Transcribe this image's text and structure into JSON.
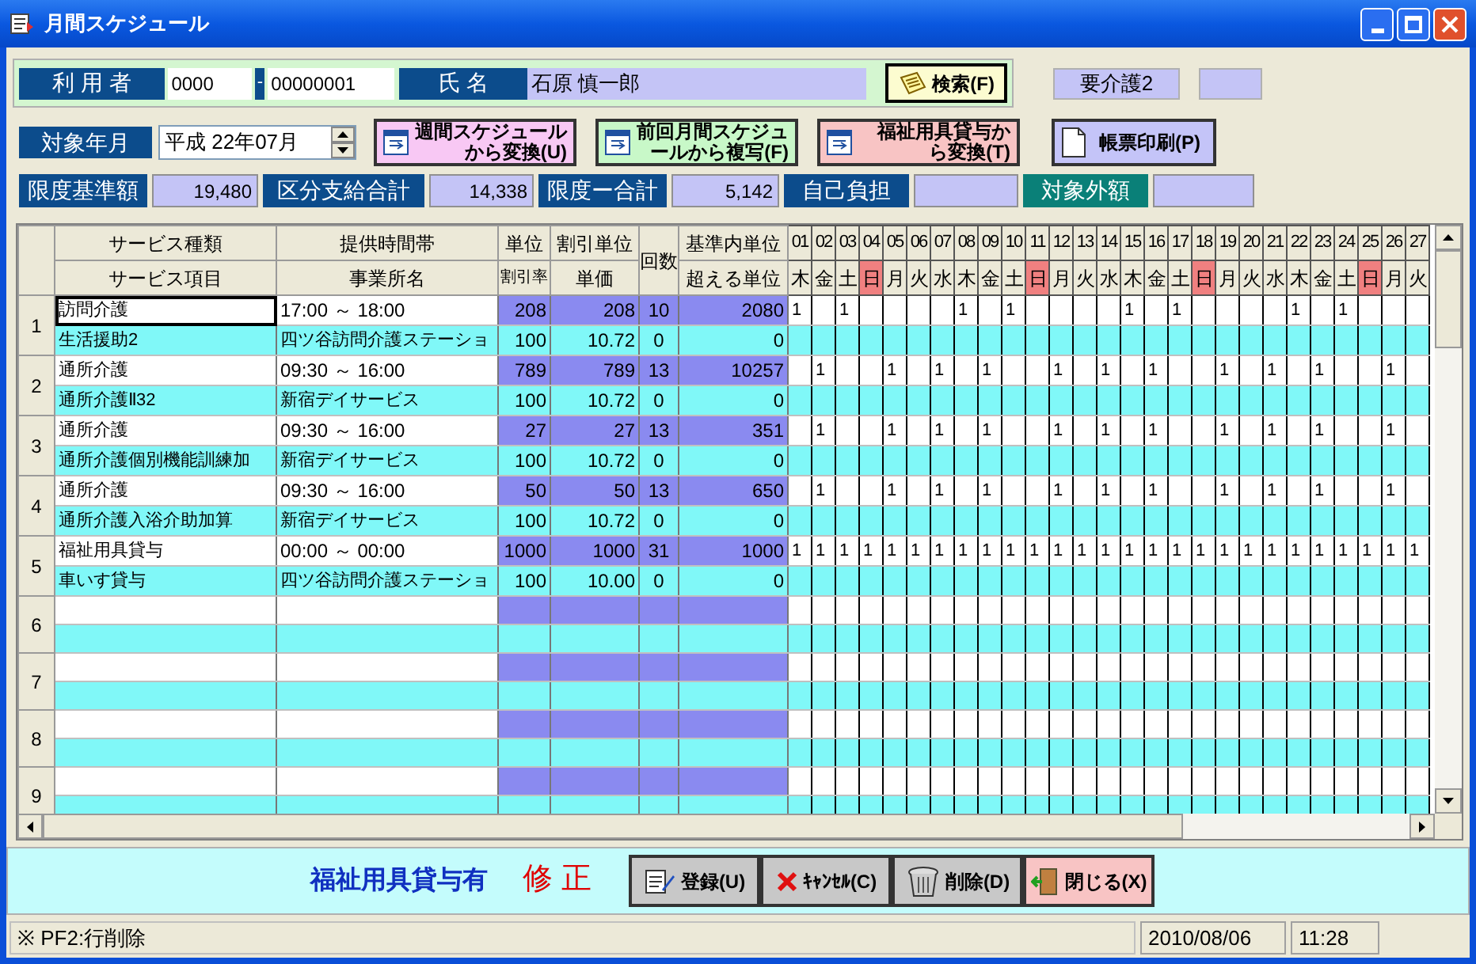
{
  "window": {
    "title": "月間スケジュール"
  },
  "user": {
    "label": "利 用 者",
    "code_prefix": "0000",
    "separator": "-",
    "code": "00000001",
    "name_label": "氏 名",
    "name": "石原 慎一郎"
  },
  "search_button": "検索(F)",
  "care_level": "要介護2",
  "period": {
    "label": "対象年月",
    "value": "平成 22年07月"
  },
  "actions": [
    {
      "kind": "convert",
      "lines": [
        "週間スケジュール",
        "から変換(U)"
      ],
      "color": "#f8c8f4"
    },
    {
      "kind": "convert",
      "lines": [
        "前回月間スケジュ",
        "ールから複写(F)"
      ],
      "color": "#c8f8c8"
    },
    {
      "kind": "convert",
      "lines": [
        "福祉用具貸与か",
        "ら変換(T)"
      ],
      "color": "#f8c4c4"
    },
    {
      "kind": "print",
      "lines": [
        "帳票印刷(P)"
      ],
      "color": "#c4c4f8"
    }
  ],
  "totals": [
    {
      "label": "限度基準額",
      "value": "19,480",
      "color": "#0c4c8c"
    },
    {
      "label": "区分支給合計",
      "value": "14,338",
      "color": "#0c4c8c"
    },
    {
      "label": "限度ー合計",
      "value": "5,142",
      "color": "#0c4c8c"
    },
    {
      "label": "自己負担",
      "color": "#0c4c8c"
    },
    {
      "label": "対象外額",
      "color": "#0a8078"
    }
  ],
  "grid": {
    "headers_top": [
      "サービス種類",
      "提供時間帯",
      "単位",
      "割引単位",
      "回数",
      "基準内単位"
    ],
    "headers_bottom": [
      "サービス項目",
      "事業所名",
      "割引率",
      "単価",
      "超える単位"
    ],
    "days": [
      {
        "date": "01",
        "weekday": "木",
        "sunday": false
      },
      {
        "date": "02",
        "weekday": "金",
        "sunday": false
      },
      {
        "date": "03",
        "weekday": "土",
        "sunday": false
      },
      {
        "date": "04",
        "weekday": "日",
        "sunday": true
      },
      {
        "date": "05",
        "weekday": "月",
        "sunday": false
      },
      {
        "date": "06",
        "weekday": "火",
        "sunday": false
      },
      {
        "date": "07",
        "weekday": "水",
        "sunday": false
      },
      {
        "date": "08",
        "weekday": "木",
        "sunday": false
      },
      {
        "date": "09",
        "weekday": "金",
        "sunday": false
      },
      {
        "date": "10",
        "weekday": "土",
        "sunday": false
      },
      {
        "date": "11",
        "weekday": "日",
        "sunday": true
      },
      {
        "date": "12",
        "weekday": "月",
        "sunday": false
      },
      {
        "date": "13",
        "weekday": "火",
        "sunday": false
      },
      {
        "date": "14",
        "weekday": "水",
        "sunday": false
      },
      {
        "date": "15",
        "weekday": "木",
        "sunday": false
      },
      {
        "date": "16",
        "weekday": "金",
        "sunday": false
      },
      {
        "date": "17",
        "weekday": "土",
        "sunday": false
      },
      {
        "date": "18",
        "weekday": "日",
        "sunday": true
      },
      {
        "date": "19",
        "weekday": "月",
        "sunday": false
      },
      {
        "date": "20",
        "weekday": "火",
        "sunday": false
      },
      {
        "date": "21",
        "weekday": "水",
        "sunday": false
      },
      {
        "date": "22",
        "weekday": "木",
        "sunday": false
      },
      {
        "date": "23",
        "weekday": "金",
        "sunday": false
      },
      {
        "date": "24",
        "weekday": "土",
        "sunday": false
      },
      {
        "date": "25",
        "weekday": "日",
        "sunday": true
      },
      {
        "date": "26",
        "weekday": "月",
        "sunday": false
      },
      {
        "date": "27",
        "weekday": "火",
        "sunday": false
      }
    ],
    "rows": [
      {
        "number": "1",
        "focused": true,
        "service_type": "訪問介護",
        "time": "17:00 ～ 18:00",
        "units": "208",
        "discount_units": "208",
        "count": "10",
        "within_units": "2080",
        "service_item": "生活援助2",
        "office": "四ツ谷訪問介護ステーショ",
        "discount_rate": "100",
        "unit_price": "10.72",
        "sub_count": "0",
        "excess_units": "0",
        "cells": [
          {
            "scheduled": true,
            "text": "1"
          },
          {
            "scheduled": false
          },
          {
            "scheduled": true,
            "text": "1"
          },
          {
            "scheduled": false
          },
          {
            "scheduled": false
          },
          {
            "scheduled": false
          },
          {
            "scheduled": false
          },
          {
            "scheduled": true,
            "text": "1"
          },
          {
            "scheduled": false
          },
          {
            "scheduled": true,
            "text": "1"
          },
          {
            "scheduled": false
          },
          {
            "scheduled": false
          },
          {
            "scheduled": false
          },
          {
            "scheduled": false
          },
          {
            "scheduled": true,
            "text": "1"
          },
          {
            "scheduled": false
          },
          {
            "scheduled": true,
            "text": "1"
          },
          {
            "scheduled": false
          },
          {
            "scheduled": false
          },
          {
            "scheduled": false
          },
          {
            "scheduled": false
          },
          {
            "scheduled": true,
            "text": "1"
          },
          {
            "scheduled": false
          },
          {
            "scheduled": true,
            "text": "1"
          },
          {
            "scheduled": false
          },
          {
            "scheduled": false
          },
          {
            "scheduled": false
          }
        ]
      },
      {
        "number": "2",
        "focused": false,
        "service_type": "通所介護",
        "time": "09:30 ～ 16:00",
        "units": "789",
        "discount_units": "789",
        "count": "13",
        "within_units": "10257",
        "service_item": "通所介護Ⅱ32",
        "office": "新宿デイサービス",
        "discount_rate": "100",
        "unit_price": "10.72",
        "sub_count": "0",
        "excess_units": "0",
        "cells": [
          {
            "scheduled": false
          },
          {
            "scheduled": true,
            "text": "1"
          },
          {
            "scheduled": false
          },
          {
            "scheduled": false
          },
          {
            "scheduled": true,
            "text": "1"
          },
          {
            "scheduled": false
          },
          {
            "scheduled": true,
            "text": "1"
          },
          {
            "scheduled": false
          },
          {
            "scheduled": true,
            "text": "1"
          },
          {
            "scheduled": false
          },
          {
            "scheduled": false
          },
          {
            "scheduled": true,
            "text": "1"
          },
          {
            "scheduled": false
          },
          {
            "scheduled": true,
            "text": "1"
          },
          {
            "scheduled": false
          },
          {
            "scheduled": true,
            "text": "1"
          },
          {
            "scheduled": false
          },
          {
            "scheduled": false
          },
          {
            "scheduled": true,
            "text": "1"
          },
          {
            "scheduled": false
          },
          {
            "scheduled": true,
            "text": "1"
          },
          {
            "scheduled": false
          },
          {
            "scheduled": true,
            "text": "1"
          },
          {
            "scheduled": false
          },
          {
            "scheduled": false
          },
          {
            "scheduled": true,
            "text": "1"
          },
          {
            "scheduled": false
          }
        ]
      },
      {
        "number": "3",
        "focused": false,
        "service_type": "通所介護",
        "time": "09:30 ～ 16:00",
        "units": "27",
        "discount_units": "27",
        "count": "13",
        "within_units": "351",
        "service_item": "通所介護個別機能訓練加",
        "office": "新宿デイサービス",
        "discount_rate": "100",
        "unit_price": "10.72",
        "sub_count": "0",
        "excess_units": "0",
        "cells": [
          {
            "scheduled": false
          },
          {
            "scheduled": true,
            "text": "1"
          },
          {
            "scheduled": false
          },
          {
            "scheduled": false
          },
          {
            "scheduled": true,
            "text": "1"
          },
          {
            "scheduled": false
          },
          {
            "scheduled": true,
            "text": "1"
          },
          {
            "scheduled": false
          },
          {
            "scheduled": true,
            "text": "1"
          },
          {
            "scheduled": false
          },
          {
            "scheduled": false
          },
          {
            "scheduled": true,
            "text": "1"
          },
          {
            "scheduled": false
          },
          {
            "scheduled": true,
            "text": "1"
          },
          {
            "scheduled": false
          },
          {
            "scheduled": true,
            "text": "1"
          },
          {
            "scheduled": false
          },
          {
            "scheduled": false
          },
          {
            "scheduled": true,
            "text": "1"
          },
          {
            "scheduled": false
          },
          {
            "scheduled": true,
            "text": "1"
          },
          {
            "scheduled": false
          },
          {
            "scheduled": true,
            "text": "1"
          },
          {
            "scheduled": false
          },
          {
            "scheduled": false
          },
          {
            "scheduled": true,
            "text": "1"
          },
          {
            "scheduled": false
          }
        ]
      },
      {
        "number": "4",
        "focused": false,
        "service_type": "通所介護",
        "time": "09:30 ～ 16:00",
        "units": "50",
        "discount_units": "50",
        "count": "13",
        "within_units": "650",
        "service_item": "通所介護入浴介助加算",
        "office": "新宿デイサービス",
        "discount_rate": "100",
        "unit_price": "10.72",
        "sub_count": "0",
        "excess_units": "0",
        "cells": [
          {
            "scheduled": false
          },
          {
            "scheduled": true,
            "text": "1"
          },
          {
            "scheduled": false
          },
          {
            "scheduled": false
          },
          {
            "scheduled": true,
            "text": "1"
          },
          {
            "scheduled": false
          },
          {
            "scheduled": true,
            "text": "1"
          },
          {
            "scheduled": false
          },
          {
            "scheduled": true,
            "text": "1"
          },
          {
            "scheduled": false
          },
          {
            "scheduled": false
          },
          {
            "scheduled": true,
            "text": "1"
          },
          {
            "scheduled": false
          },
          {
            "scheduled": true,
            "text": "1"
          },
          {
            "scheduled": false
          },
          {
            "scheduled": true,
            "text": "1"
          },
          {
            "scheduled": false
          },
          {
            "scheduled": false
          },
          {
            "scheduled": true,
            "text": "1"
          },
          {
            "scheduled": false
          },
          {
            "scheduled": true,
            "text": "1"
          },
          {
            "scheduled": false
          },
          {
            "scheduled": true,
            "text": "1"
          },
          {
            "scheduled": false
          },
          {
            "scheduled": false
          },
          {
            "scheduled": true,
            "text": "1"
          },
          {
            "scheduled": false
          }
        ]
      },
      {
        "number": "5",
        "focused": false,
        "service_type": "福祉用具貸与",
        "time": "00:00 ～ 00:00",
        "units": "1000",
        "discount_units": "1000",
        "count": "31",
        "within_units": "1000",
        "service_item": "車いす貸与",
        "office": "四ツ谷訪問介護ステーショ",
        "discount_rate": "100",
        "unit_price": "10.00",
        "sub_count": "0",
        "excess_units": "0",
        "cells": [
          {
            "scheduled": true,
            "text": "1"
          },
          {
            "scheduled": true,
            "text": "1"
          },
          {
            "scheduled": true,
            "text": "1"
          },
          {
            "scheduled": true,
            "text": "1"
          },
          {
            "scheduled": true,
            "text": "1"
          },
          {
            "scheduled": true,
            "text": "1"
          },
          {
            "scheduled": true,
            "text": "1"
          },
          {
            "scheduled": true,
            "text": "1"
          },
          {
            "scheduled": true,
            "text": "1"
          },
          {
            "scheduled": true,
            "text": "1"
          },
          {
            "scheduled": true,
            "text": "1"
          },
          {
            "scheduled": true,
            "text": "1"
          },
          {
            "scheduled": true,
            "text": "1"
          },
          {
            "scheduled": true,
            "text": "1"
          },
          {
            "scheduled": true,
            "text": "1"
          },
          {
            "scheduled": true,
            "text": "1"
          },
          {
            "scheduled": true,
            "text": "1"
          },
          {
            "scheduled": true,
            "text": "1"
          },
          {
            "scheduled": true,
            "text": "1"
          },
          {
            "scheduled": true,
            "text": "1"
          },
          {
            "scheduled": true,
            "text": "1"
          },
          {
            "scheduled": true,
            "text": "1"
          },
          {
            "scheduled": true,
            "text": "1"
          },
          {
            "scheduled": true,
            "text": "1"
          },
          {
            "scheduled": true,
            "text": "1"
          },
          {
            "scheduled": true,
            "text": "1"
          },
          {
            "scheduled": true,
            "text": "1"
          }
        ]
      }
    ],
    "blank_rows": [
      "6",
      "7",
      "8",
      "9"
    ]
  },
  "footer": {
    "note": "福祉用具貸与有",
    "mode": "修 正",
    "buttons": [
      {
        "kind": "save",
        "label": "登録(U)"
      },
      {
        "kind": "cancel",
        "label": "ｷｬﾝｾﾙ(C)"
      },
      {
        "kind": "delete",
        "label": "削除(D)"
      },
      {
        "kind": "close",
        "label": "閉じる(X)"
      }
    ]
  },
  "status_bar": {
    "hint": "※ PF2:行削除",
    "date": "2010/08/06",
    "time": "11:28"
  }
}
